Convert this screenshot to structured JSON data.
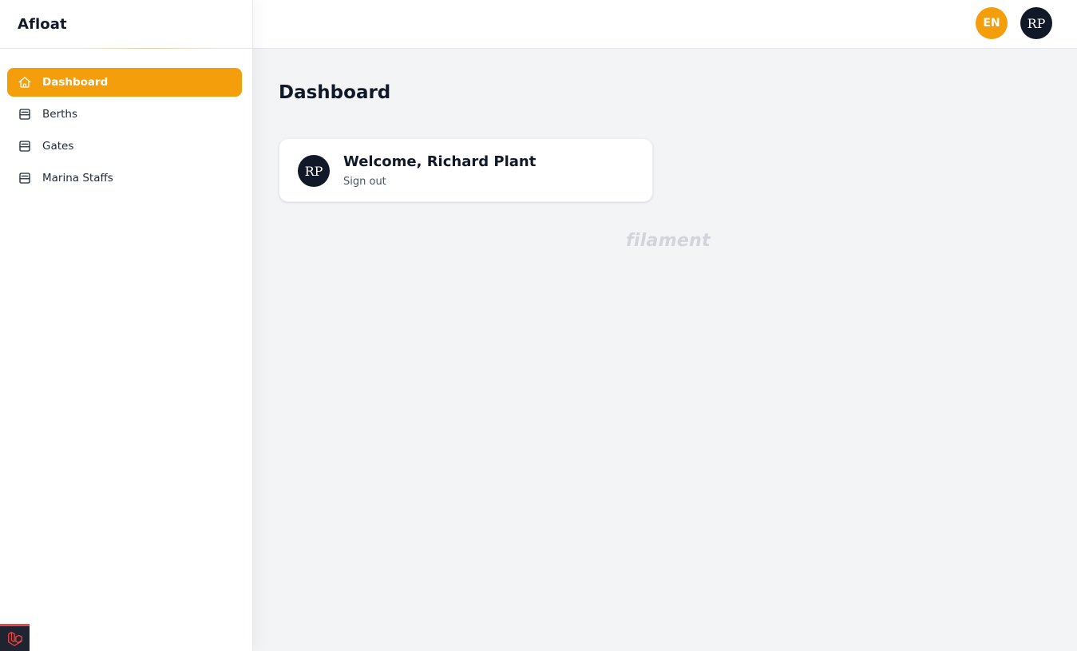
{
  "sidebar": {
    "brand": "Afloat",
    "items": [
      {
        "label": "Dashboard",
        "icon": "home-icon",
        "active": true
      },
      {
        "label": "Berths",
        "icon": "inbox-icon",
        "active": false
      },
      {
        "label": "Gates",
        "icon": "inbox-icon",
        "active": false
      },
      {
        "label": "Marina Staffs",
        "icon": "inbox-icon",
        "active": false
      }
    ]
  },
  "topbar": {
    "language": "EN",
    "user_initials": "RP"
  },
  "main": {
    "title": "Dashboard",
    "welcome": {
      "avatar_initials": "RP",
      "greeting": "Welcome, Richard Plant",
      "sign_out": "Sign out"
    },
    "watermark": "filament"
  },
  "colors": {
    "accent": "#f59e0b",
    "dark": "#111827",
    "background": "#f3f4f6"
  }
}
